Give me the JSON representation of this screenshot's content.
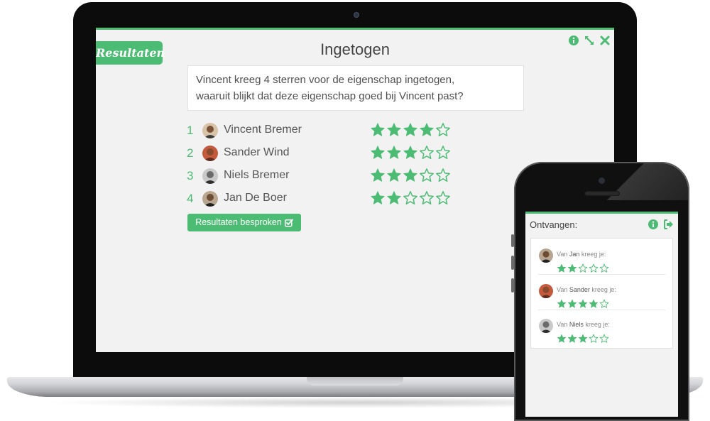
{
  "brand": {
    "accent": "#4cbb73",
    "background": "#f2f2f2"
  },
  "laptop": {
    "badge": "Resultaten",
    "window_icons": [
      "info-icon",
      "expand-icon",
      "close-icon"
    ],
    "title": "Ingetogen",
    "message_line1": "Vincent kreeg 4 sterren voor de eigenschap ingetogen,",
    "message_line2": "waaruit blijkt dat deze eigenschap goed bij Vincent past?",
    "rankings": [
      {
        "rank": "1",
        "name": "Vincent Bremer",
        "stars": 4,
        "max": 5
      },
      {
        "rank": "2",
        "name": "Sander Wind",
        "stars": 3,
        "max": 5
      },
      {
        "rank": "3",
        "name": "Niels Bremer",
        "stars": 3,
        "max": 5
      },
      {
        "rank": "4",
        "name": "Jan De Boer",
        "stars": 2,
        "max": 5
      }
    ],
    "button_label": "Resultaten besproken",
    "button_icon": "check-square-icon"
  },
  "phone": {
    "title": "Ontvangen:",
    "icons": [
      "info-icon",
      "sign-out-icon"
    ],
    "items": [
      {
        "prefix": "Van ",
        "name": "Jan",
        "suffix": " kreeg je:",
        "stars": 2,
        "max": 5
      },
      {
        "prefix": "Van ",
        "name": "Sander",
        "suffix": " kreeg je:",
        "stars": 4,
        "max": 5
      },
      {
        "prefix": "Van ",
        "name": "Niels",
        "suffix": " kreeg je:",
        "stars": 3,
        "max": 5
      }
    ]
  }
}
